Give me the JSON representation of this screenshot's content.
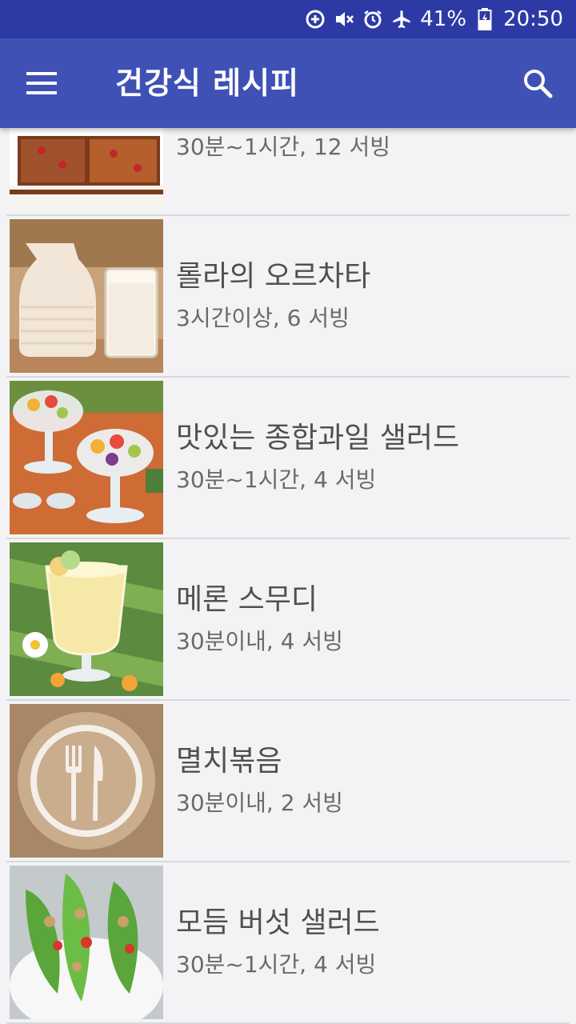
{
  "status": {
    "battery": "41%",
    "time": "20:50"
  },
  "appbar": {
    "title": "건강식 레시피"
  },
  "recipes": [
    {
      "title": "",
      "meta": "30분~1시간, 12 서빙"
    },
    {
      "title": "롤라의 오르차타",
      "meta": "3시간이상, 6 서빙"
    },
    {
      "title": "맛있는 종합과일 샐러드",
      "meta": "30분~1시간, 4 서빙"
    },
    {
      "title": "메론 스무디",
      "meta": "30분이내, 4 서빙"
    },
    {
      "title": "멸치볶음",
      "meta": "30분이내, 2 서빙"
    },
    {
      "title": "모듬 버섯 샐러드",
      "meta": "30분~1시간, 4 서빙"
    }
  ]
}
